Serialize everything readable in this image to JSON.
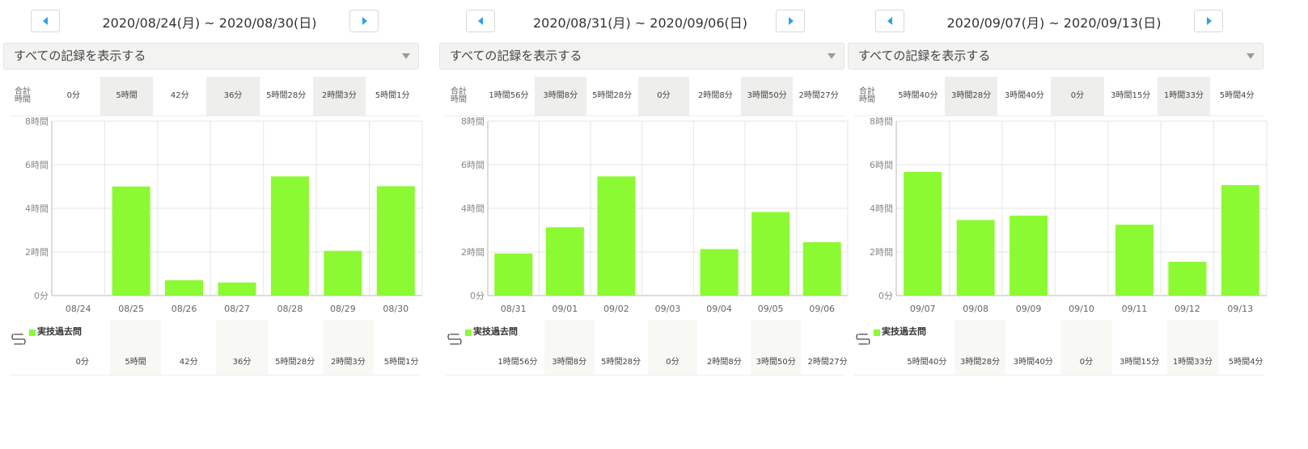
{
  "colors": {
    "bar": "#8cfa32",
    "nav_arrow": "#29a3e6",
    "grid": "#e6e6e6",
    "axis": "#bbbbbb",
    "shade": "#eeefec"
  },
  "filter": {
    "label": "すべての記録を表示する"
  },
  "totals_label": "合計時間",
  "series_name": "実技過去問",
  "panels": [
    {
      "range": "2020/08/24(月) ~ 2020/08/30(日)",
      "totals": [
        "0分",
        "5時間",
        "42分",
        "36分",
        "5時間28分",
        "2時間3分",
        "5時間1分"
      ]
    },
    {
      "range": "2020/08/31(月) ~ 2020/09/06(日)",
      "totals": [
        "1時間56分",
        "3時間8分",
        "5時間28分",
        "0分",
        "2時間8分",
        "3時間50分",
        "2時間27分"
      ]
    },
    {
      "range": "2020/09/07(月) ~ 2020/09/13(日)",
      "totals": [
        "5時間40分",
        "3時間28分",
        "3時間40分",
        "0分",
        "3時間15分",
        "1時間33分",
        "5時間4分"
      ]
    }
  ],
  "chart_data": [
    {
      "type": "bar",
      "categories": [
        "08/24",
        "08/25",
        "08/26",
        "08/27",
        "08/28",
        "08/29",
        "08/30"
      ],
      "series": [
        {
          "name": "実技過去問",
          "values": [
            0,
            300,
            42,
            36,
            328,
            123,
            301
          ]
        }
      ],
      "value_unit": "minutes",
      "ylim": [
        0,
        480
      ],
      "yticks": [
        0,
        120,
        240,
        360,
        480
      ],
      "ytick_labels": [
        "0分",
        "2時間",
        "4時間",
        "6時間",
        "8時間"
      ],
      "grid": true,
      "legend": "bottom-left"
    },
    {
      "type": "bar",
      "categories": [
        "08/31",
        "09/01",
        "09/02",
        "09/03",
        "09/04",
        "09/05",
        "09/06"
      ],
      "series": [
        {
          "name": "実技過去問",
          "values": [
            116,
            188,
            328,
            0,
            128,
            230,
            147
          ]
        }
      ],
      "value_unit": "minutes",
      "ylim": [
        0,
        480
      ],
      "yticks": [
        0,
        120,
        240,
        360,
        480
      ],
      "ytick_labels": [
        "0分",
        "2時間",
        "4時間",
        "6時間",
        "8時間"
      ],
      "grid": true,
      "legend": "bottom-left"
    },
    {
      "type": "bar",
      "categories": [
        "09/07",
        "09/08",
        "09/09",
        "09/10",
        "09/11",
        "09/12",
        "09/13"
      ],
      "series": [
        {
          "name": "実技過去問",
          "values": [
            340,
            208,
            220,
            0,
            195,
            93,
            304
          ]
        }
      ],
      "value_unit": "minutes",
      "ylim": [
        0,
        480
      ],
      "yticks": [
        0,
        120,
        240,
        360,
        480
      ],
      "ytick_labels": [
        "0分",
        "2時間",
        "4時間",
        "6時間",
        "8時間"
      ],
      "grid": true,
      "legend": "bottom-left"
    }
  ]
}
